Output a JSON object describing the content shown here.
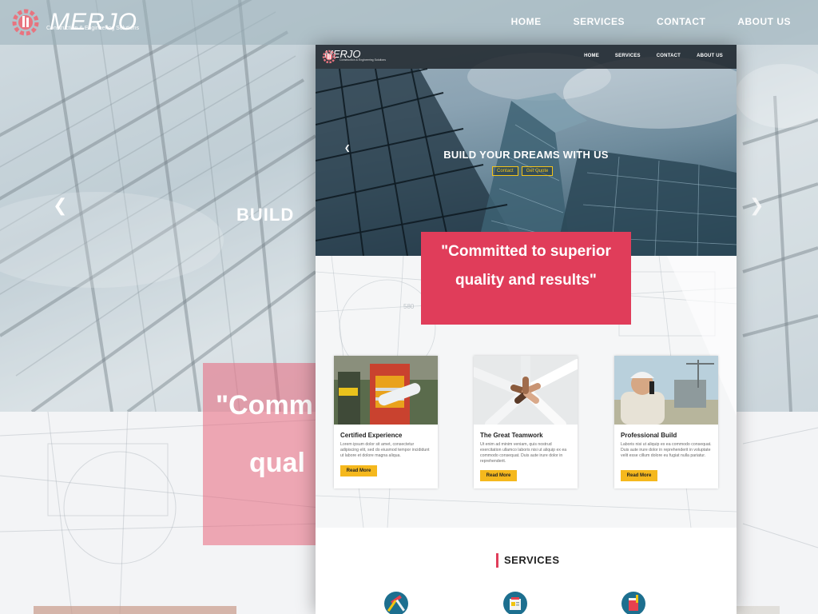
{
  "background": {
    "brand": {
      "name": "MERJO",
      "tagline": "Construction & Engineering Solutions"
    },
    "nav": [
      "HOME",
      "SERVICES",
      "CONTACT",
      "ABOUT US"
    ],
    "hero_text": "BUILD",
    "quote_line1": "\"Comm",
    "quote_line2": "qual"
  },
  "mockup": {
    "brand": {
      "name": "MERJO",
      "tagline": "Construction & Engineering Solutions"
    },
    "nav": [
      "HOME",
      "SERVICES",
      "CONTACT",
      "ABOUT US"
    ],
    "hero": {
      "headline": "BUILD YOUR DREAMS WITH US",
      "buttons": [
        "Contact",
        "Get Quote"
      ]
    },
    "quote": {
      "line1": "\"Committed to superior",
      "line2": "quality and results\""
    },
    "cards": [
      {
        "title": "Certified Experience",
        "text": "Lorem ipsum dolor sit amet, consectetur adipiscing elit, sed do eiusmod tempor incididunt ut labore et dolore magna aliqua.",
        "button": "Read More"
      },
      {
        "title": "The Great Teamwork",
        "text": "Ut enim ad minim veniam, quis nostrud exercitation ullamco laboris nisi ut aliquip ex ea commodo consequat. Duis aute irure dolor in reprehenderit.",
        "button": "Read More"
      },
      {
        "title": "Professional Build",
        "text": "Laboris nisi ut aliquip ex ea commodo consequat. Duis aute irure dolor in reprehenderit in voluptate velit esse cillum dolore eu fugiat nulla pariatur.",
        "button": "Read More"
      }
    ],
    "services_title": "SERVICES"
  },
  "colors": {
    "accent_red": "#e03d5a",
    "button_yellow": "#f5b81d",
    "service_icon_teal": "#1d6f8f",
    "header_dark": "#191e24"
  },
  "icons": [
    "gear-logo-icon",
    "chevron-left-icon",
    "chevron-right-icon",
    "tools-icon",
    "blueprint-icon",
    "paint-bucket-icon"
  ]
}
